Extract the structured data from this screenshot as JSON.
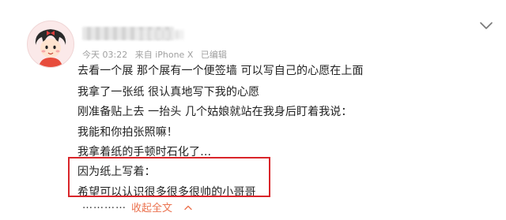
{
  "post": {
    "meta": {
      "time": "今天 03:22",
      "source": "来自 iPhone X",
      "edited": "已编辑"
    },
    "lines": [
      "去看一个展 那个展有一个便签墙 可以写自己的心愿在上面",
      "我拿了一张纸 很认真地写下我的心愿",
      "刚准备贴上去 一抬头 几个姑娘就站在我身后盯着我说：",
      "我能和你拍张照嘛！",
      "我拿着纸的手顿时石化了…",
      "因为纸上写着：",
      "希望可以认识很多很多很帅的小哥哥"
    ],
    "ellipsis": "…………",
    "collapse_label": "收起全文"
  },
  "colors": {
    "highlight_border": "#d9252a",
    "link": "#eb7350",
    "meta": "#a0a0a0"
  },
  "icons": {
    "avatar": "cartoon-girl-avatar",
    "menu": "chevron-down-icon",
    "collapse": "chevron-up-icon"
  }
}
